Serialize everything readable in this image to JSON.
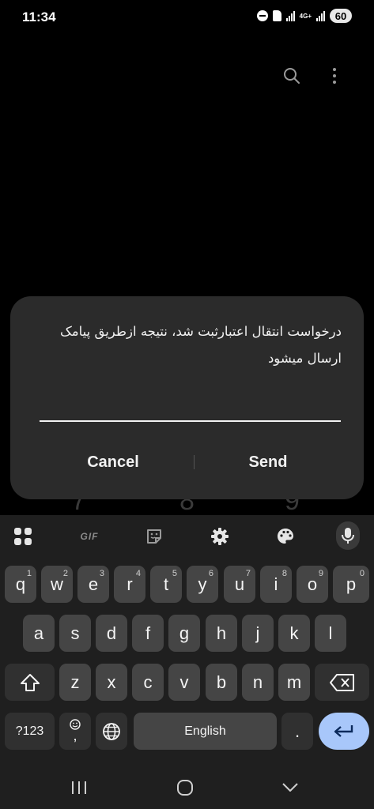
{
  "status_bar": {
    "time": "11:34",
    "network": "4G+",
    "battery": "60"
  },
  "top_actions": {
    "search_icon": "search-icon",
    "more_icon": "more-vertical-icon"
  },
  "dialog": {
    "message_line1": "درخواست انتقال اعتبارثبت شد، نتیجه ازطریق پیامک",
    "message_line2": "ارسال میشود",
    "input_value": "",
    "cancel_label": "Cancel",
    "send_label": "Send"
  },
  "background_dialpad": {
    "digits": [
      "7",
      "8",
      "9"
    ]
  },
  "keyboard": {
    "toolbar": {
      "apps_icon": "grid-icon",
      "gif_label": "GIF",
      "sticker_icon": "sticker-icon",
      "settings_icon": "gear-icon",
      "theme_icon": "palette-icon",
      "mic_icon": "mic-icon"
    },
    "row1": [
      {
        "label": "q",
        "hint": "1"
      },
      {
        "label": "w",
        "hint": "2"
      },
      {
        "label": "e",
        "hint": "3"
      },
      {
        "label": "r",
        "hint": "4"
      },
      {
        "label": "t",
        "hint": "5"
      },
      {
        "label": "y",
        "hint": "6"
      },
      {
        "label": "u",
        "hint": "7"
      },
      {
        "label": "i",
        "hint": "8"
      },
      {
        "label": "o",
        "hint": "9"
      },
      {
        "label": "p",
        "hint": "0"
      }
    ],
    "row2": [
      "a",
      "s",
      "d",
      "f",
      "g",
      "h",
      "j",
      "k",
      "l"
    ],
    "row3": [
      "z",
      "x",
      "c",
      "v",
      "b",
      "n",
      "m"
    ],
    "bottom": {
      "symbols_label": "?123",
      "emoji_comma": ",",
      "space_label": "English",
      "period_label": "."
    },
    "accent_color": "#a8c7fa"
  },
  "navbar": {
    "recents_icon": "recents-icon",
    "home_icon": "home-icon",
    "back_icon": "back-chevron-icon"
  }
}
